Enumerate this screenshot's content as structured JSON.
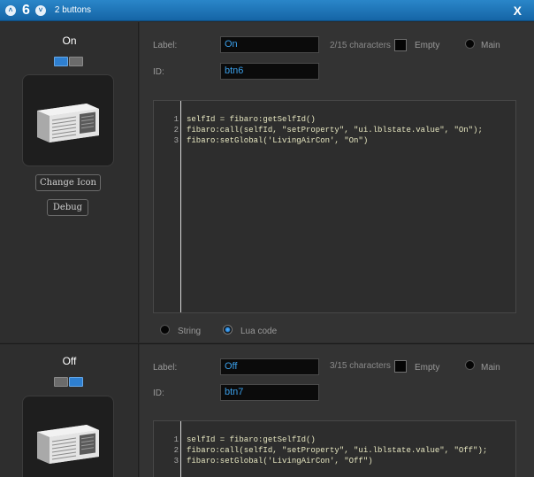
{
  "titlebar": {
    "number": "6",
    "title": "2 buttons",
    "close": "X",
    "up_glyph": "˄",
    "down_glyph": "˅"
  },
  "buttons": [
    {
      "display_name": "On",
      "label_caption": "Label:",
      "label_value": "On",
      "char_count": "2/15 characters",
      "empty_label": "Empty",
      "main_label": "Main",
      "id_caption": "ID:",
      "id_value": "btn6",
      "change_icon": "Change Icon",
      "debug": "Debug",
      "code": [
        {
          "n": "1",
          "text": "selfId = fibaro:getSelfId()"
        },
        {
          "n": "2",
          "text": "fibaro:call(selfId, \"setProperty\", \"ui.lblstate.value\", \"On\");"
        },
        {
          "n": "3",
          "text": "fibaro:setGlobal('LivingAirCon', \"On\")"
        }
      ],
      "mode_string": "String",
      "mode_lua": "Lua code",
      "selected_mode": "Lua code",
      "toggle_state": "left-active"
    },
    {
      "display_name": "Off",
      "label_caption": "Label:",
      "label_value": "Off",
      "char_count": "3/15 characters",
      "empty_label": "Empty",
      "main_label": "Main",
      "id_caption": "ID:",
      "id_value": "btn7",
      "code": [
        {
          "n": "1",
          "text": "selfId = fibaro:getSelfId()"
        },
        {
          "n": "2",
          "text": "fibaro:call(selfId, \"setProperty\", \"ui.lblstate.value\", \"Off\");"
        },
        {
          "n": "3",
          "text": "fibaro:setGlobal('LivingAirCon', \"Off\")"
        }
      ],
      "toggle_state": "right-active"
    }
  ],
  "colors": {
    "titlebar": "#1f78bd",
    "accent_blue": "#2e7fd0",
    "field_text": "#3a9ee8",
    "code_text": "#e6e6c0"
  },
  "icons": [
    "chevron-up-icon",
    "chevron-down-icon",
    "close-icon",
    "air-conditioner-icon"
  ]
}
